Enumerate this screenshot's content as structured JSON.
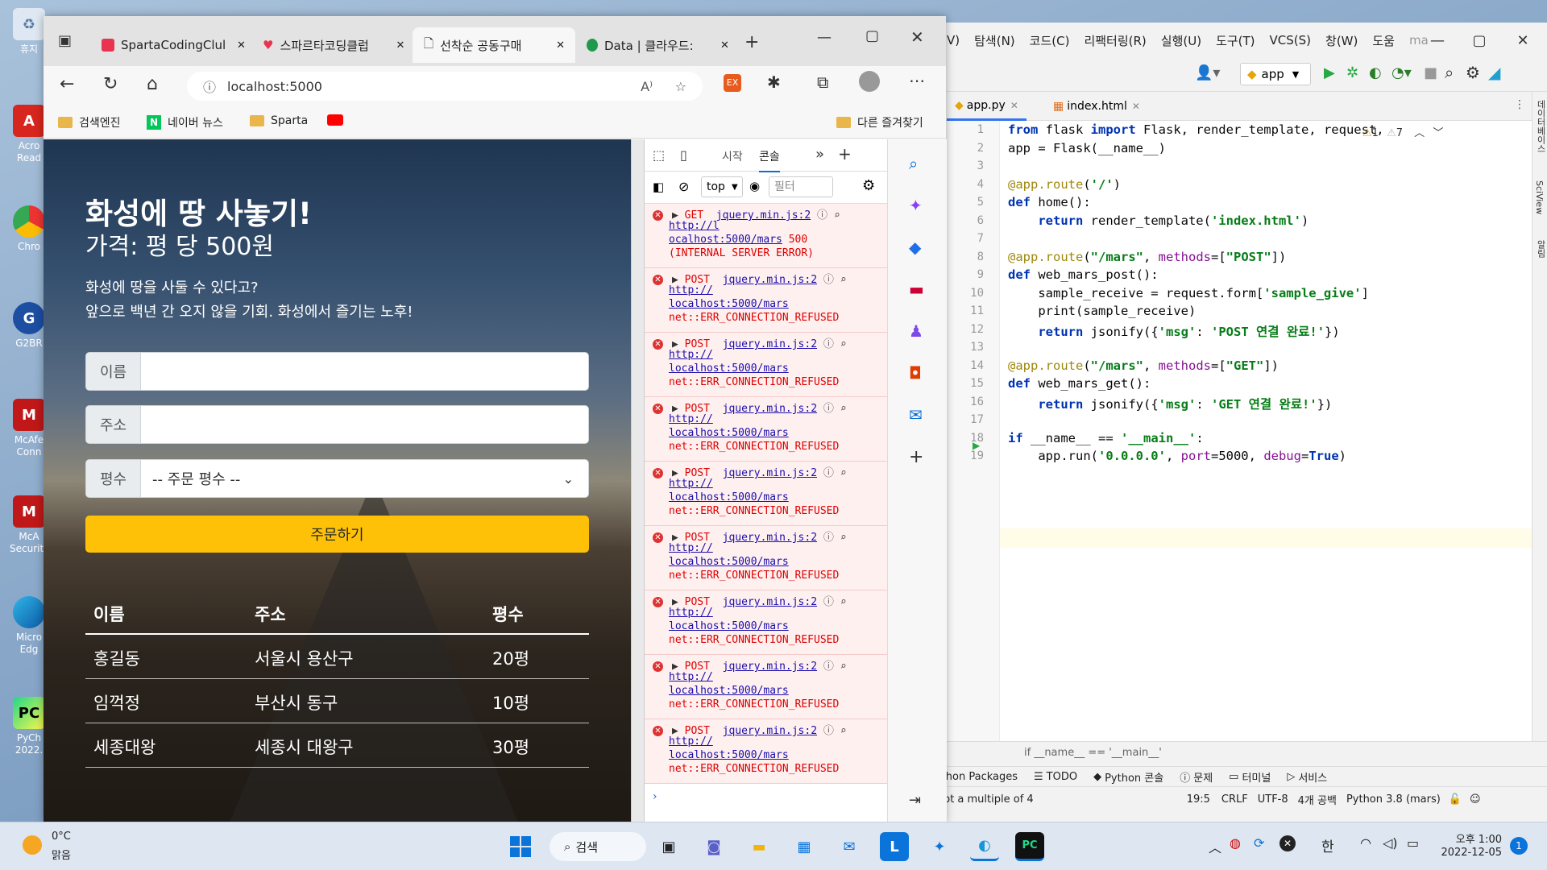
{
  "desktop": {
    "icons": [
      {
        "label": "휴지"
      },
      {
        "label": "Acro\nRead"
      },
      {
        "label": "Chro"
      },
      {
        "label": "G2BR"
      },
      {
        "label": "McAfe\nConn"
      },
      {
        "label": "McA\nSecurity"
      },
      {
        "label": "Micro\nEdg"
      },
      {
        "label": "PyCh\n2022."
      }
    ]
  },
  "browser": {
    "tabs": [
      {
        "title": "SpartaCodingClul"
      },
      {
        "title": "스파르타코딩클럽"
      },
      {
        "title": "선착순 공동구매"
      },
      {
        "title": "Data | 클라우드:"
      }
    ],
    "url": "localhost:5000",
    "favorites": [
      "검색엔진",
      "네이버 뉴스",
      "Sparta"
    ],
    "other_favorites": "다른 즐겨찾기"
  },
  "page": {
    "title": "화성에 땅 사놓기!",
    "price": "가격: 평 당 500원",
    "desc1": "화성에 땅을 사둘 수 있다고?",
    "desc2": "앞으로 백년 간 오지 않을 기회. 화성에서 즐기는 노후!",
    "name_label": "이름",
    "address_label": "주소",
    "size_label": "평수",
    "size_select": "-- 주문 평수 --",
    "order_button": "주문하기",
    "table": {
      "headers": [
        "이름",
        "주소",
        "평수"
      ],
      "rows": [
        [
          "홍길동",
          "서울시 용산구",
          "20평"
        ],
        [
          "임꺽정",
          "부산시 동구",
          "10평"
        ],
        [
          "세종대왕",
          "세종시 대왕구",
          "30평"
        ]
      ]
    }
  },
  "devtools": {
    "tabs": [
      "시작",
      "콘솔"
    ],
    "context": "top",
    "filter_placeholder": "필터",
    "logs": [
      {
        "method": "GET",
        "src": "jquery.min.js:2",
        "lines": [
          "http://l",
          "ocalhost:5000/mars",
          "(INTERNAL SERVER ERROR)"
        ],
        "status": "500"
      },
      {
        "method": "POST",
        "src": "jquery.min.js:2",
        "lines": [
          "http://",
          "localhost:5000/mars",
          "net::ERR_CONNECTION_REFUSED"
        ]
      },
      {
        "method": "POST",
        "src": "jquery.min.js:2",
        "lines": [
          "http://",
          "localhost:5000/mars",
          "net::ERR_CONNECTION_REFUSED"
        ]
      },
      {
        "method": "POST",
        "src": "jquery.min.js:2",
        "lines": [
          "http://",
          "localhost:5000/mars",
          "net::ERR_CONNECTION_REFUSED"
        ]
      },
      {
        "method": "POST",
        "src": "jquery.min.js:2",
        "lines": [
          "http://",
          "localhost:5000/mars",
          "net::ERR_CONNECTION_REFUSED"
        ]
      },
      {
        "method": "POST",
        "src": "jquery.min.js:2",
        "lines": [
          "http://",
          "localhost:5000/mars",
          "net::ERR_CONNECTION_REFUSED"
        ]
      },
      {
        "method": "POST",
        "src": "jquery.min.js:2",
        "lines": [
          "http://",
          "localhost:5000/mars",
          "net::ERR_CONNECTION_REFUSED"
        ]
      },
      {
        "method": "POST",
        "src": "jquery.min.js:2",
        "lines": [
          "http://",
          "localhost:5000/mars",
          "net::ERR_CONNECTION_REFUSED"
        ]
      },
      {
        "method": "POST",
        "src": "jquery.min.js:2",
        "lines": [
          "http://",
          "localhost:5000/mars",
          "net::ERR_CONNECTION_REFUSED"
        ]
      }
    ]
  },
  "ide": {
    "menu": [
      "V)",
      "탐색(N)",
      "코드(C)",
      "리팩터링(R)",
      "실행(U)",
      "도구(T)",
      "VCS(S)",
      "창(W)",
      "도움",
      "ma"
    ],
    "run_config": "app",
    "tabs": [
      "app.py",
      "index.html"
    ],
    "warnings": "1",
    "weak_warnings": "7",
    "code_lines": [
      "from flask import Flask, render_template, request,",
      "app = Flask(__name__)",
      "",
      "@app.route('/')",
      "def home():",
      "    return render_template('index.html')",
      "",
      "@app.route(\"/mars\", methods=[\"POST\"])",
      "def web_mars_post():",
      "    sample_receive = request.form['sample_give']",
      "    print(sample_receive)",
      "    return jsonify({'msg': 'POST 연결 완료!'})",
      "",
      "@app.route(\"/mars\", methods=[\"GET\"])",
      "def web_mars_get():",
      "    return jsonify({'msg': 'GET 연결 완료!'})",
      "",
      "if __name__ == '__main__':",
      "    app.run('0.0.0.0', port=5000, debug=True)"
    ],
    "breadcrumb": "if __name__ == '__main__'",
    "bottom_tabs": [
      "ython Packages",
      "TODO",
      "Python 콘솔",
      "문제",
      "터미널",
      "서비스"
    ],
    "status_msg": "not a multiple of 4",
    "status": {
      "pos": "19:5",
      "eol": "CRLF",
      "enc": "UTF-8",
      "indent": "4개 공백",
      "interp": "Python 3.8 (mars)"
    },
    "side_labels": [
      "데이터베이스",
      "SciView",
      "알림"
    ]
  },
  "taskbar": {
    "weather_temp": "0°C",
    "weather_desc": "맑음",
    "search": "검색",
    "ime": "한",
    "time": "오후 1:00",
    "date": "2022-12-05",
    "notif_count": "1"
  }
}
